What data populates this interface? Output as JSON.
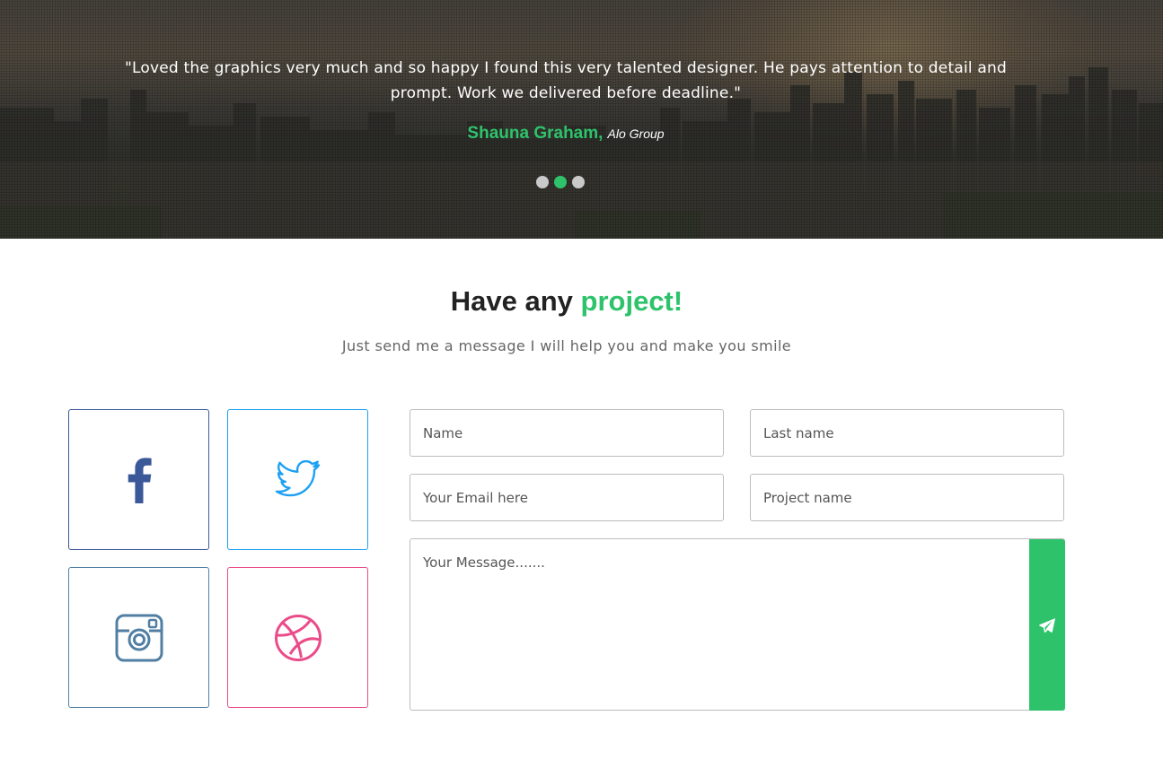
{
  "testimonial": {
    "quote": "\"Loved the graphics very much and so happy I found this very talented designer. He pays attention to detail and prompt. Work we delivered before deadline.\"",
    "author_name": "Shauna Graham,",
    "author_company": "Alo Group",
    "slides": 3,
    "active_slide": 2
  },
  "contact": {
    "heading_prefix": "Have any",
    "heading_accent": "project!",
    "subheading": "Just send me a message I will help you and make you smile"
  },
  "social": [
    {
      "name": "facebook",
      "icon": "facebook-icon",
      "color": "#3b5998"
    },
    {
      "name": "twitter",
      "icon": "twitter-icon",
      "color": "#1da1f2"
    },
    {
      "name": "instagram",
      "icon": "instagram-icon",
      "color": "#517fa4"
    },
    {
      "name": "dribbble",
      "icon": "dribbble-icon",
      "color": "#ea4c89"
    }
  ],
  "form": {
    "name_placeholder": "Name",
    "last_name_placeholder": "Last name",
    "email_placeholder": "Your Email here",
    "project_placeholder": "Project name",
    "message_placeholder": "Your Message.......",
    "send_icon": "paper-plane-icon"
  },
  "colors": {
    "accent": "#2ec36b",
    "facebook": "#3b5998",
    "twitter": "#1da1f2",
    "instagram": "#517fa4",
    "dribbble": "#ea4c89"
  }
}
